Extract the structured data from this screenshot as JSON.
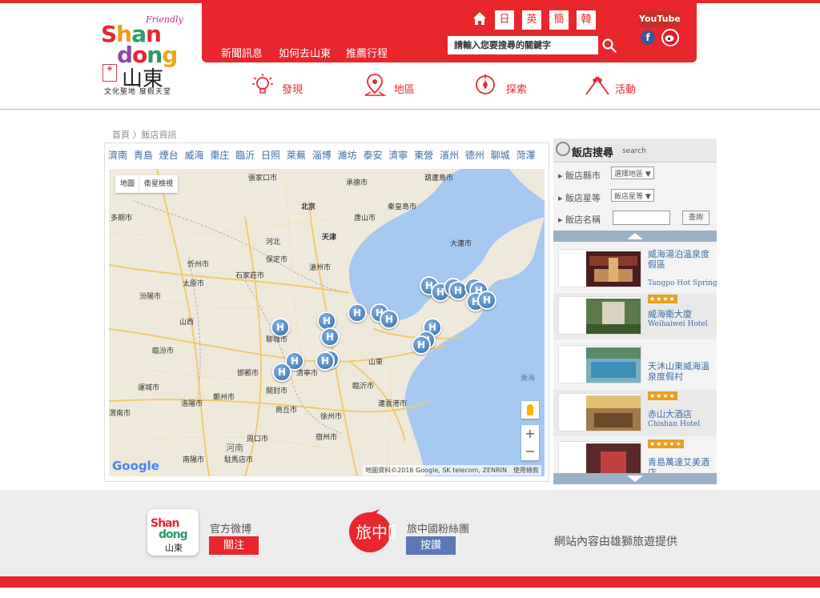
{
  "logo": {
    "friendly": "Friendly",
    "line1": "Shan",
    "line2": "dong",
    "chinese": "山東",
    "slogan": "文化聖地 度假天堂"
  },
  "header": {
    "nav": [
      "新聞訊息",
      "如何去山東",
      "推薦行程"
    ],
    "languages": [
      "日",
      "英",
      "簡",
      "韓"
    ],
    "search_placeholder": "請輸入您要搜尋的關鍵字",
    "youtube": "YouTube",
    "facebook": "f"
  },
  "icon_nav": [
    {
      "label": "發現",
      "icon": "lightbulb-icon"
    },
    {
      "label": "地區",
      "icon": "map-pin-icon"
    },
    {
      "label": "探索",
      "icon": "compass-icon"
    },
    {
      "label": "活動",
      "icon": "flags-icon"
    }
  ],
  "breadcrumb": "首頁 〉飯店資訊",
  "cities": [
    "濟南",
    "青島",
    "煙台",
    "威海",
    "棗庄",
    "臨沂",
    "日照",
    "萊蕪",
    "淄博",
    "濰坊",
    "泰安",
    "濟寧",
    "東營",
    "濱州",
    "德州",
    "聊城",
    "菏澤"
  ],
  "map": {
    "toggle_map": "地圖",
    "toggle_satellite": "衛星檢視",
    "google": "Google",
    "attribution": "地圖資料©2016 Google, SK telecom, ZENRIN　使用條款",
    "labels": [
      {
        "text": "張家口市"
      },
      {
        "text": "承德市"
      },
      {
        "text": "葫蘆島市"
      },
      {
        "text": "北京"
      },
      {
        "text": "唐山市"
      },
      {
        "text": "秦皇島市"
      },
      {
        "text": "天津"
      },
      {
        "text": "多期市"
      },
      {
        "text": "保定市"
      },
      {
        "text": "大連市"
      },
      {
        "text": "忻州市"
      },
      {
        "text": "滄州市"
      },
      {
        "text": "石家莊市"
      },
      {
        "text": "太原市"
      },
      {
        "text": "河北"
      },
      {
        "text": "汾陽市"
      },
      {
        "text": "山西"
      },
      {
        "text": "聊城市"
      },
      {
        "text": "臨汾市"
      },
      {
        "text": "邯鄲市"
      },
      {
        "text": "濟寧市"
      },
      {
        "text": "山東"
      },
      {
        "text": "臨沂市"
      },
      {
        "text": "運城市"
      },
      {
        "text": "洛陽市"
      },
      {
        "text": "鄭州市"
      },
      {
        "text": "開封市"
      },
      {
        "text": "連雲港市"
      },
      {
        "text": "商丘市"
      },
      {
        "text": "徐州市"
      },
      {
        "text": "渭南市"
      },
      {
        "text": "周口市"
      },
      {
        "text": "宿州市"
      },
      {
        "text": "河南"
      },
      {
        "text": "南陽市"
      },
      {
        "text": "駐馬店市"
      },
      {
        "text": "黃海"
      }
    ],
    "zoom_in": "+",
    "zoom_out": "−",
    "marker_label": "H"
  },
  "side": {
    "title": "飯店搜尋",
    "title_en": "search",
    "city_label": "飯店縣市",
    "city_value": "選擇地區 ▼",
    "star_label": "飯店星等",
    "star_value": "飯店星等 ▼",
    "name_label": "飯店名稱",
    "query_button": "查詢",
    "hotels": [
      {
        "name_zh": "威海湯泊溫泉度假區",
        "name_en": "Tangpo Hot Spring",
        "stars": ""
      },
      {
        "name_zh": "威海衛大廈",
        "name_en": "Weihaiwei Hotel",
        "stars": "★★★★"
      },
      {
        "name_zh": "天沐山東威海溫泉度假村",
        "name_en": "",
        "stars": ""
      },
      {
        "name_zh": "赤山大酒店",
        "name_en": "Chishan Hotel",
        "stars": "★★★★"
      },
      {
        "name_zh": "青島萬達艾美酒店",
        "name_en": "",
        "stars": "★★★★★"
      }
    ]
  },
  "footer": {
    "weibo_label": "官方微博",
    "follow_button": "關注",
    "fans_label": "旅中國粉絲團",
    "like_button": "按讚",
    "provided": "網站內容由雄獅旅遊提供",
    "lvxing_logo_text": "旅中國"
  },
  "colors": {
    "brand_red": "#e8262c",
    "link_blue": "#3a6ea5",
    "marker_blue": "#2a6aa8",
    "like_button": "#5a78b6"
  }
}
